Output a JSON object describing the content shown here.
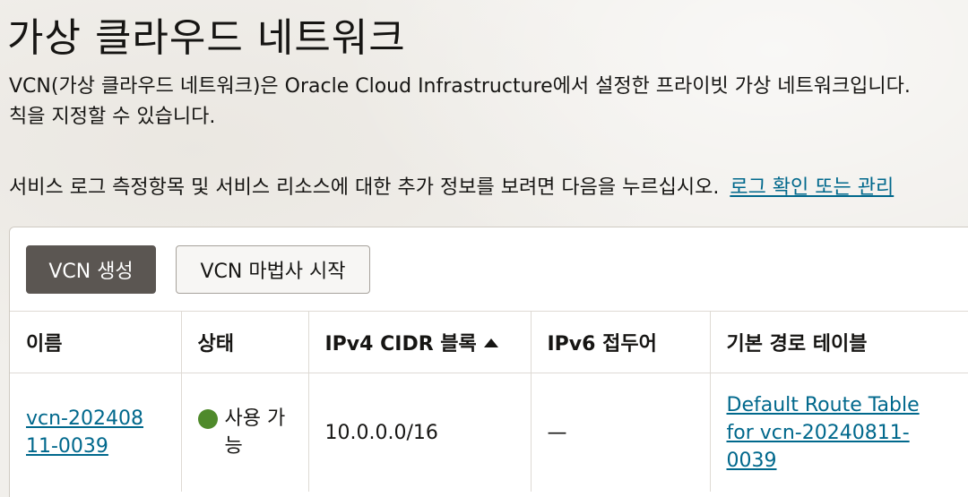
{
  "page": {
    "title": "가상 클라우드 네트워크",
    "description_line1": "VCN(가상 클라우드 네트워크)은 Oracle Cloud Infrastructure에서 설정한 프라이빗 가상 네트워크입니다.",
    "description_line2": "칙을 지정할 수 있습니다.",
    "logs_text": "서비스 로그 측정항목 및 서비스 리소스에 대한 추가 정보를 보려면 다음을 누르십시오.",
    "logs_link": "로그 확인 또는 관리"
  },
  "toolbar": {
    "create_label": "VCN 생성",
    "wizard_label": "VCN 마법사 시작"
  },
  "table": {
    "columns": [
      "이름",
      "상태",
      "IPv4 CIDR 블록",
      "IPv6 접두어",
      "기본 경로 테이블"
    ],
    "sorted_column": "IPv4 CIDR 블록",
    "sort_direction": "ascending",
    "rows": [
      {
        "name": "vcn-20240811-0039",
        "status": "사용 가능",
        "status_color": "#4f8a2b",
        "ipv4_cidr": "10.0.0.0/16",
        "ipv6_prefix": "—",
        "default_route_table": "Default Route Table for vcn-20240811-0039"
      }
    ]
  },
  "colors": {
    "primary_button": "#5b5652",
    "link": "#00688c"
  }
}
